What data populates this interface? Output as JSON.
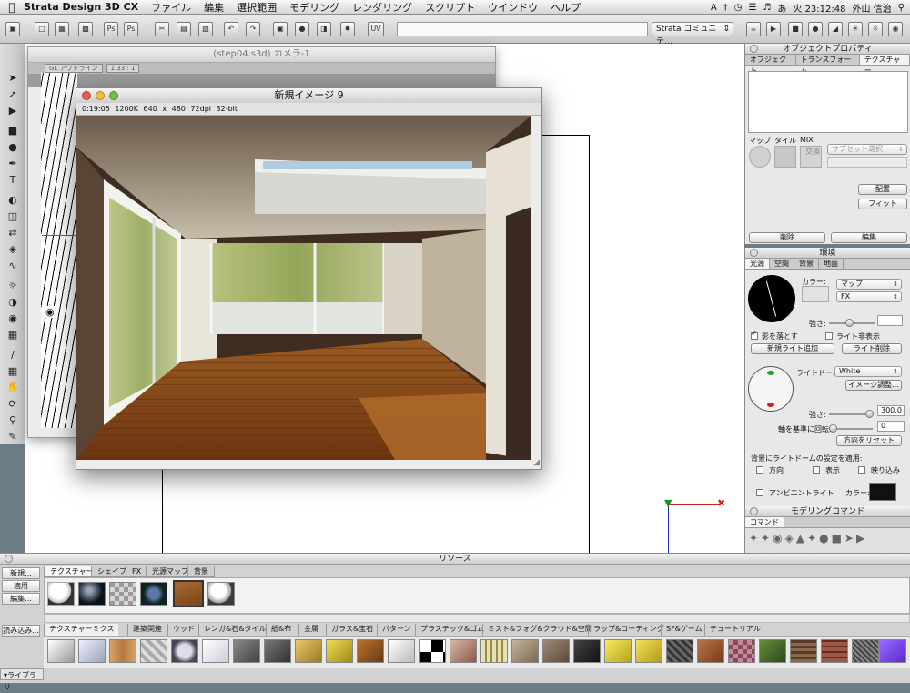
{
  "menubar": {
    "app_name": "Strata Design 3D CX",
    "items": [
      "ファイル",
      "編集",
      "選択範囲",
      "モデリング",
      "レンダリング",
      "スクリプト",
      "ウインドウ",
      "ヘルプ"
    ],
    "clock": "火 23:12:48",
    "user": "外山 信治"
  },
  "toolbar": {
    "community_select": "Strata コミュニテ…",
    "misc_label": "UV"
  },
  "camera_window": {
    "title": "(step04.s3d) カメラ-1",
    "view_mode": "GL アウトライン",
    "zoom": "1.33 : 1"
  },
  "render_window": {
    "title": "新規イメージ 9",
    "info": "0:19:05   1200K   640 x 480   72dpi   32-bit"
  },
  "object_properties": {
    "title": "オブジェクトプロパティ",
    "tabs": [
      "オブジェクト",
      "トランスフォーム",
      "テクスチャー"
    ],
    "labels": [
      "マップ",
      "タイル",
      "MIX"
    ],
    "exchange": "交換",
    "subset_select": "サブセット選択",
    "place_button": "配置",
    "fit_button": "フィット",
    "delete_button": "削除",
    "edit_button": "編集"
  },
  "environment": {
    "title": "環境",
    "tabs": [
      "光源",
      "空間",
      "背景",
      "地面"
    ],
    "color_label": "カラー:",
    "map_select": "マップ",
    "fx_select": "FX",
    "strength_label": "強さ:",
    "cast_shadow": "影を落とす",
    "light_hidden": "ライト非表示",
    "add_light": "新規ライト追加",
    "delete_light": "ライト削除",
    "light_dome_label": "ライトドーム:",
    "light_dome_value": "White",
    "image_adjust": "イメージ調整...",
    "strength_value": "300.0",
    "rotate_label": "軸を基準に回転:",
    "rotate_value": "0",
    "reset_direction": "方向をリセット",
    "apply_label": "背景にライトドームの設定を適用:",
    "direction": "方向",
    "display": "表示",
    "blur": "映り込み",
    "ambient_light": "アンビエントライト",
    "ambient_color_label": "カラー:"
  },
  "modeling_commands": {
    "title": "モデリングコマンド",
    "tab": "コマンド"
  },
  "resources": {
    "title": "リソース",
    "tabs": [
      "テクスチャー",
      "シェイプ",
      "FX",
      "光源マップ",
      "背景"
    ],
    "buttons": [
      "新規...",
      "適用",
      "編集..."
    ],
    "load_button": "読み込み...",
    "library_label": "ライブラリ",
    "library_tabs": [
      "テクスチャーミクス",
      "建築関連",
      "ウッド",
      "レンガ&石&タイル",
      "紙&布",
      "金属",
      "ガラス&宝石",
      "パターン",
      "プラスチック&ゴム",
      "ミスト&フォグ&クラウド&空間",
      "ラップ&コーティング",
      "SF&ゲーム",
      "チュートリアル"
    ]
  },
  "colors": {
    "ambient_swatch": "#111111",
    "floor": "#7a3f14",
    "selection": "#2b6fd6"
  }
}
